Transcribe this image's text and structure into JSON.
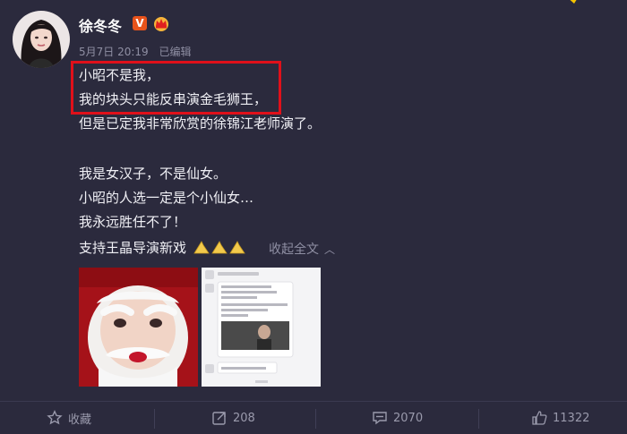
{
  "user": {
    "name": "徐冬冬",
    "verified_badge": "V"
  },
  "meta": {
    "date": "5月7日 20:19",
    "edited": "已编辑"
  },
  "post": {
    "lines": [
      "小昭不是我，",
      "我的块头只能反串演金毛狮王，",
      "但是已定我非常欣赏的徐锦江老师演了。",
      "我是女汉子，不是仙女。",
      "小昭的人选一定是个小仙女…",
      "我永远胜任不了！",
      "支持王晶导演新戏"
    ],
    "collapse_label": "收起全文"
  },
  "footer": {
    "favorite": "收藏",
    "repost": "208",
    "comment": "2070",
    "like": "11322"
  },
  "icons": [
    "crown-icon",
    "star-icon",
    "repost-icon",
    "comment-icon",
    "like-icon",
    "praying-hands-icon",
    "chevron-up-icon"
  ],
  "colors": {
    "background": "#2b2a3d",
    "highlight": "#e0101a",
    "verified": "#e8531b"
  }
}
